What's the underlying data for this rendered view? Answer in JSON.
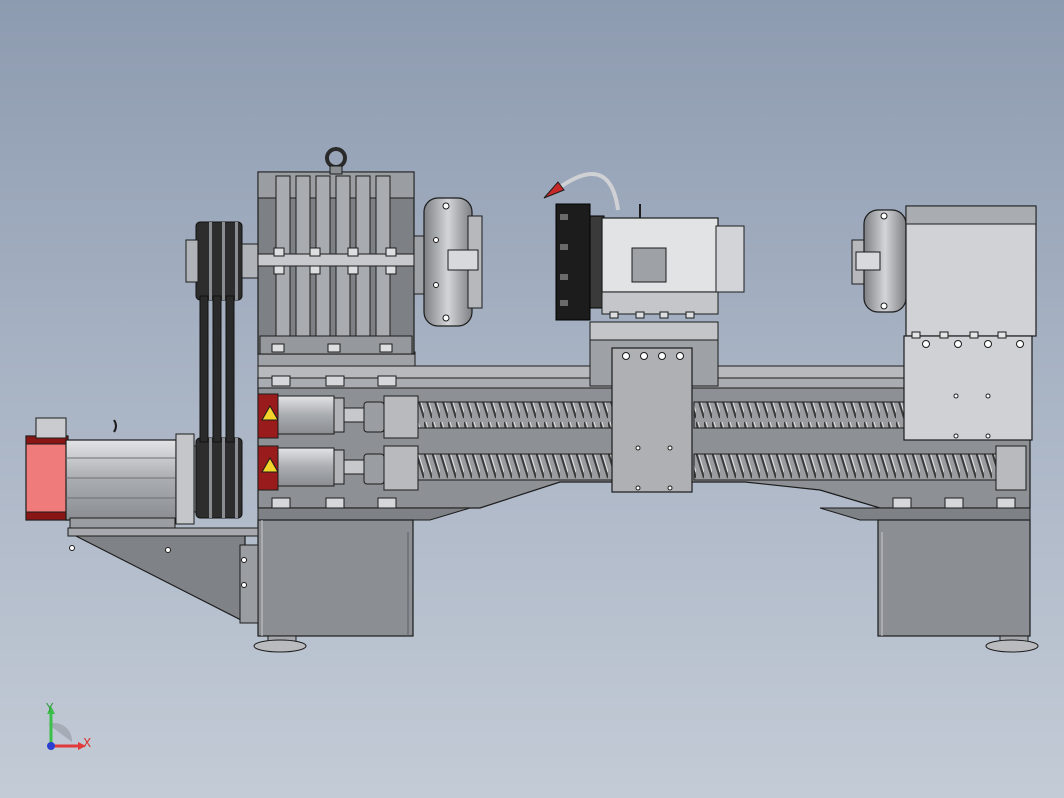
{
  "triad": {
    "x_label": "X",
    "y_label": "Y"
  },
  "colors": {
    "background_top": "#8d9bb0",
    "background_bottom": "#c3cbd6",
    "metal": "#8f9296",
    "metal_light": "#c9cbce",
    "outline": "#1c1c1c",
    "motor_red": "#ef7b7b",
    "motor_dark_red": "#8a1515",
    "warning_yellow": "#f2d42a",
    "x_axis": "#e03a3a",
    "y_axis": "#3bbf4a",
    "z_axis": "#2b3fd0"
  },
  "components": [
    "base-frame",
    "left-base-leg",
    "right-base-leg",
    "main-motor",
    "v-belt-drive",
    "headstock",
    "left-chuck",
    "carriage",
    "tool-turret",
    "spindle-motor",
    "right-chuck",
    "tailstock",
    "upper-ballscrew",
    "lower-ballscrew",
    "upper-servo-motor",
    "lower-servo-motor",
    "leveling-feet"
  ]
}
